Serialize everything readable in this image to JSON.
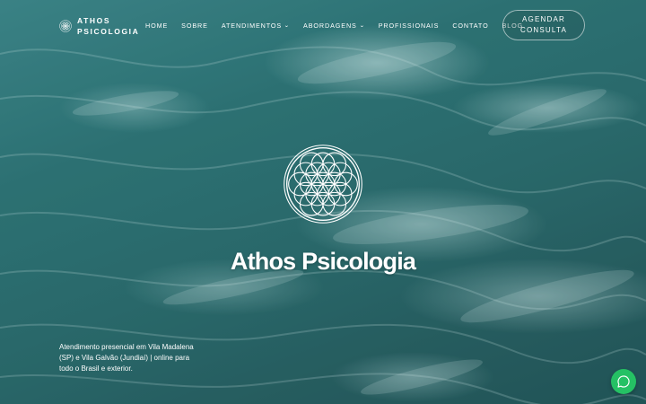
{
  "brand": {
    "line1": "ATHOS",
    "line2": "PSICOLOGIA",
    "logo_icon": "flower-of-life-icon"
  },
  "nav": {
    "home": "HOME",
    "sobre": "SOBRE",
    "atendimentos": "ATENDIMENTOS",
    "abordagens": "ABORDAGENS",
    "profissionais": "PROFISSIONAIS",
    "contato": "CONTATO",
    "blog": "BLOG",
    "dropdown_icon": "chevron-down-icon"
  },
  "cta": {
    "line1": "AGENDAR",
    "line2": "CONSULTA"
  },
  "hero": {
    "title": "Athos Psicologia",
    "description": "Atendimento presencial em Vila Madalena (SP) e Vila Galvão (Jundiaí) | online para todo o Brasil e exterior.",
    "logo_icon": "flower-of-life-icon"
  },
  "chat": {
    "icon": "whatsapp-icon",
    "color": "#25c164"
  },
  "colors": {
    "water": "#2f7779",
    "text": "#ffffff"
  }
}
